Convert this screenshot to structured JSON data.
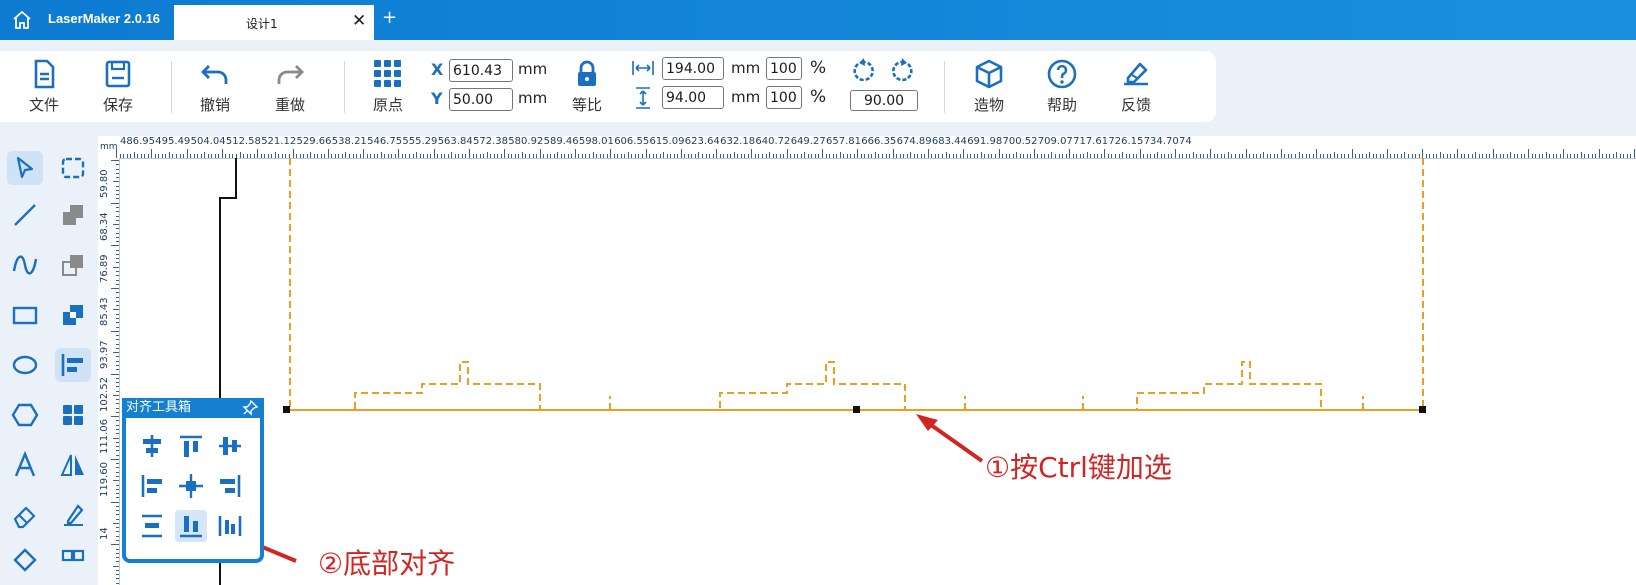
{
  "titlebar": {
    "app_name": "LaserMaker 2.0.16",
    "tab_title": "设计1",
    "tab_close": "✕",
    "new_tab": "+"
  },
  "toolbar": {
    "file": "文件",
    "save": "保存",
    "undo": "撤销",
    "redo": "重做",
    "origin": "原点",
    "x_label": "X",
    "y_label": "Y",
    "x_value": "610.43",
    "y_value": "50.00",
    "unit": "mm",
    "proportional": "等比",
    "width_value": "194.00",
    "height_value": "94.00",
    "width_percent": "100",
    "height_percent": "100",
    "percent_sign": "%",
    "rotation_value": "90.00",
    "build": "造物",
    "help": "帮助",
    "feedback": "反馈"
  },
  "ruler": {
    "unit": "mm",
    "h_labels": [
      "486.95",
      "495.49",
      "504.04",
      "512.58",
      "521.12",
      "529.66",
      "538.21",
      "546.75",
      "555.29",
      "563.84",
      "572.38",
      "580.92",
      "589.46",
      "598.01",
      "606.55",
      "615.09",
      "623.64",
      "632.18",
      "640.72",
      "649.27",
      "657.81",
      "666.35",
      "674.89",
      "683.44",
      "691.98",
      "700.52",
      "709.07",
      "717.61",
      "726.15",
      "734.70",
      "74"
    ],
    "v_labels": [
      "59.80",
      "68.34",
      "76.89",
      "85.43",
      "93.97",
      "102.52",
      "111.06",
      "119.60",
      "14"
    ]
  },
  "align_toolbox": {
    "title": "对齐工具箱"
  },
  "annotations": {
    "step1": "①按Ctrl键加选",
    "step2": "②底部对齐"
  },
  "colors": {
    "accent": "#1480cf",
    "shape": "#e8a020",
    "arrow": "#d32424"
  }
}
